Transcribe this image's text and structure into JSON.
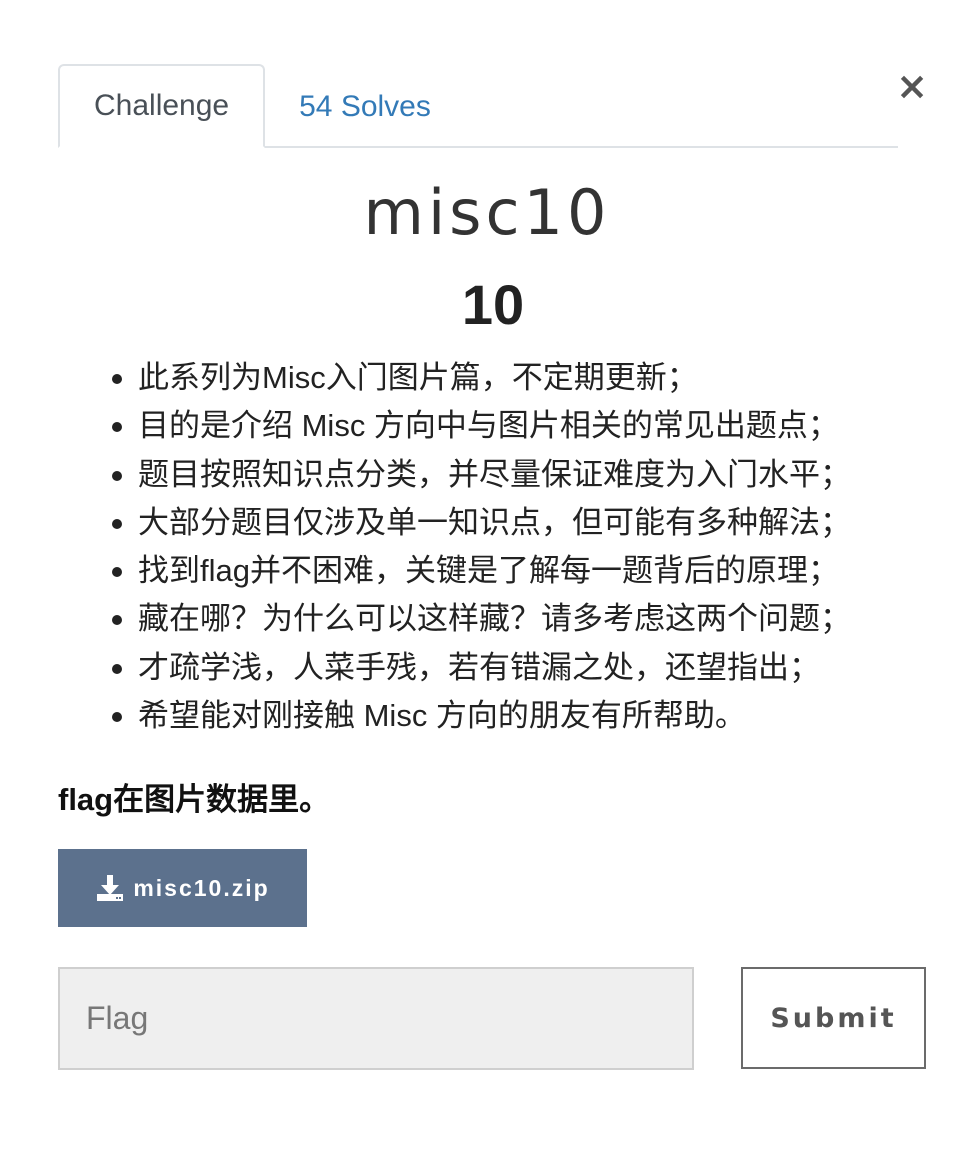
{
  "modal": {
    "close_label": "×"
  },
  "tabs": [
    {
      "label": "Challenge",
      "active": true
    },
    {
      "label": "54 Solves",
      "active": false
    }
  ],
  "challenge": {
    "name": "misc10",
    "value": "10",
    "description_items": [
      "此系列为Misc入门图片篇，不定期更新；",
      "目的是介绍 Misc 方向中与图片相关的常见出题点；",
      "题目按照知识点分类，并尽量保证难度为入门水平；",
      "大部分题目仅涉及单一知识点，但可能有多种解法；",
      "找到flag并不困难，关键是了解每一题背后的原理；",
      "藏在哪？为什么可以这样藏？请多考虑这两个问题；",
      "才疏学浅，人菜手残，若有错漏之处，还望指出；",
      "希望能对刚接触 Misc 方向的朋友有所帮助。"
    ],
    "hint": "flag在图片数据里。",
    "file": {
      "label": "misc10.zip",
      "icon": "download-icon"
    }
  },
  "flag_form": {
    "placeholder": "Flag",
    "value": "",
    "submit_label": "Submit"
  },
  "colors": {
    "link": "#337ab7",
    "download_button": "#5c718d"
  }
}
